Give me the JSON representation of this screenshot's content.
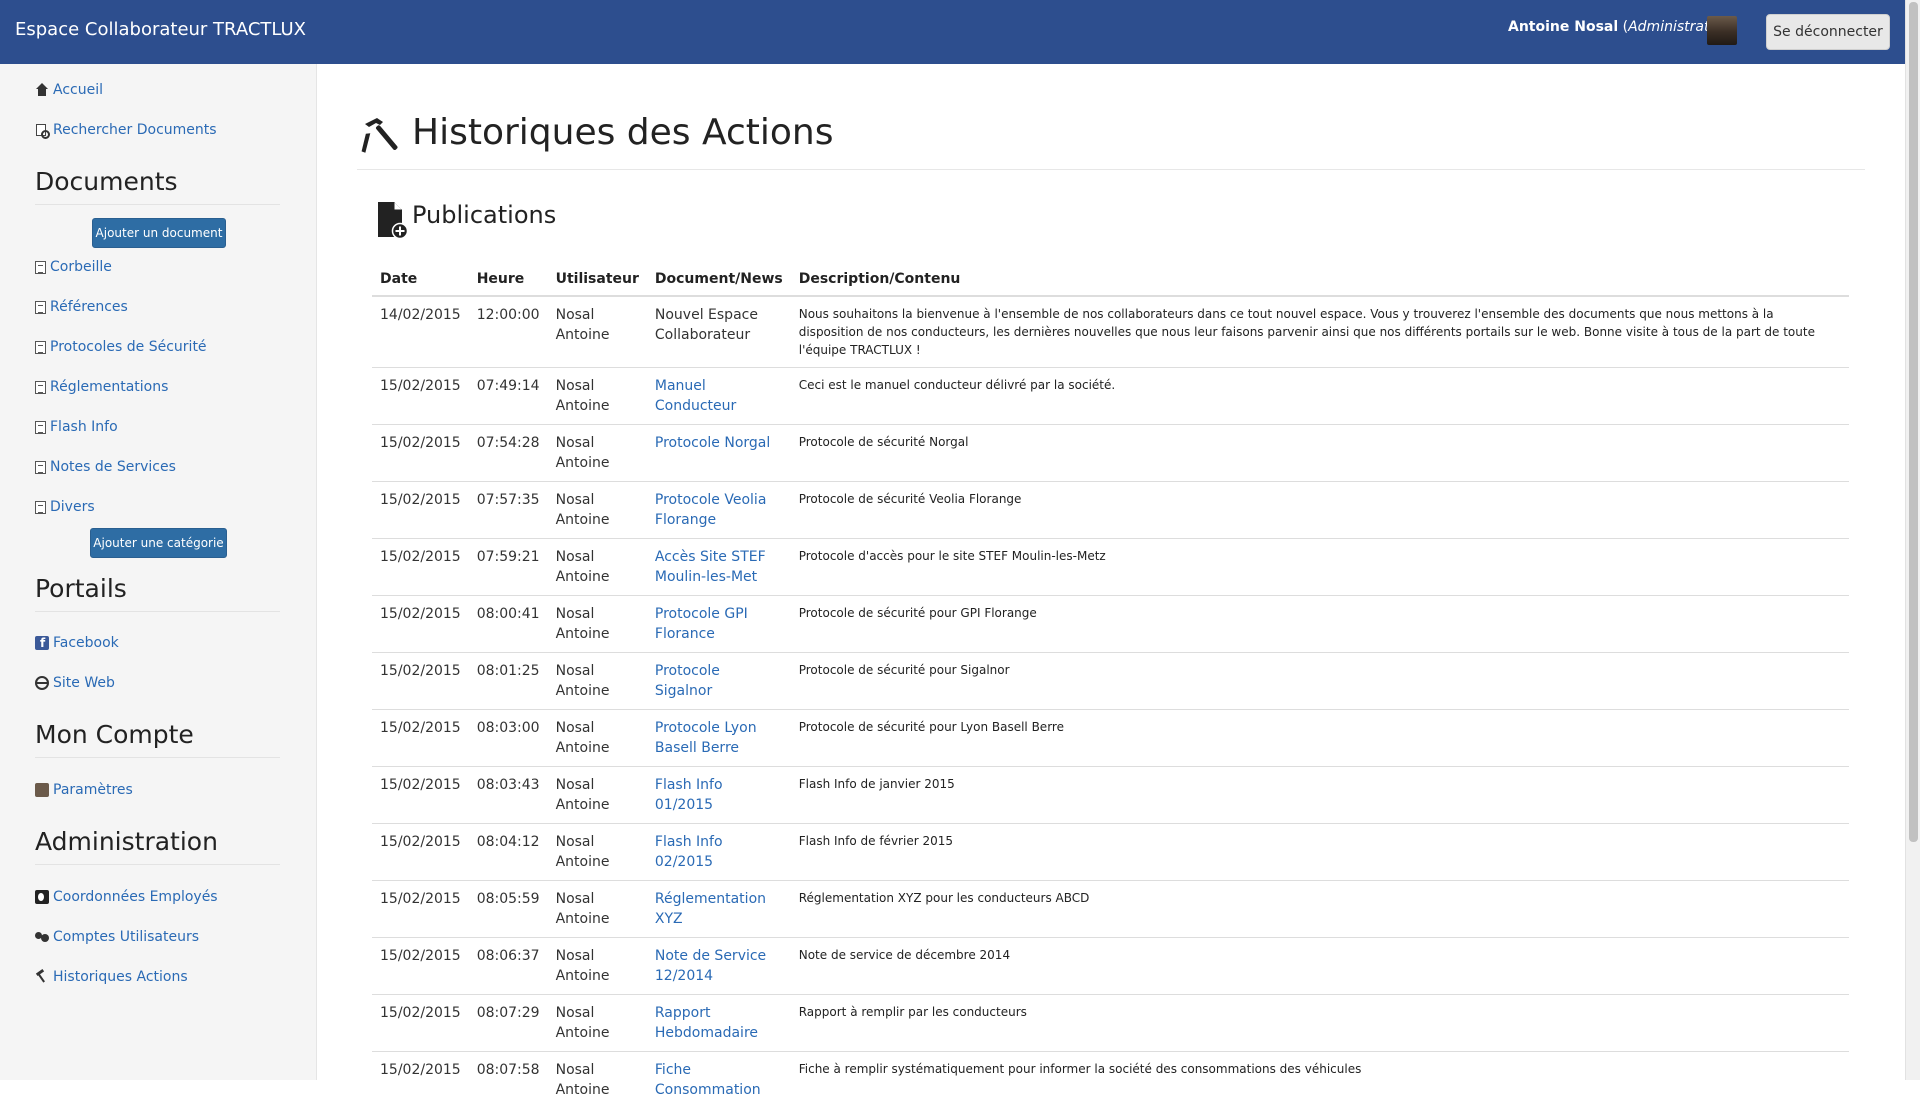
{
  "navbar": {
    "brand": "Espace Collaborateur TRACTLUX",
    "user_name": "Antoine Nosal",
    "user_role": "Administrateur",
    "logout_label": "Se déconnecter"
  },
  "sidebar": {
    "top_links": [
      {
        "label": "Accueil",
        "icon": "home-icon"
      },
      {
        "label": "Rechercher Documents",
        "icon": "search-document-icon"
      }
    ],
    "documents": {
      "title": "Documents",
      "add_document_label": "Ajouter un document",
      "items": [
        {
          "label": "Corbeille",
          "icon": "document-icon"
        },
        {
          "label": "Références",
          "icon": "document-icon"
        },
        {
          "label": "Protocoles de Sécurité",
          "icon": "document-icon"
        },
        {
          "label": "Réglementations",
          "icon": "document-icon"
        },
        {
          "label": "Flash Info",
          "icon": "document-icon"
        },
        {
          "label": "Notes de Services",
          "icon": "document-icon"
        },
        {
          "label": "Divers",
          "icon": "document-icon"
        }
      ],
      "add_category_label": "Ajouter une catégorie"
    },
    "portails": {
      "title": "Portails",
      "items": [
        {
          "label": "Facebook",
          "icon": "facebook-icon"
        },
        {
          "label": "Site Web",
          "icon": "globe-icon"
        }
      ]
    },
    "compte": {
      "title": "Mon Compte",
      "items": [
        {
          "label": "Paramètres",
          "icon": "user-photo-icon"
        }
      ]
    },
    "admin": {
      "title": "Administration",
      "items": [
        {
          "label": "Coordonnées Employés",
          "icon": "contact-card-icon"
        },
        {
          "label": "Comptes Utilisateurs",
          "icon": "users-icon"
        },
        {
          "label": "Historiques Actions",
          "icon": "hammer-icon"
        }
      ]
    }
  },
  "main": {
    "title": "Historiques des Actions",
    "section_title": "Publications",
    "columns": [
      "Date",
      "Heure",
      "Utilisateur",
      "Document/News",
      "Description/Contenu"
    ],
    "rows": [
      {
        "date": "14/02/2015",
        "time": "12:00:00",
        "user_line1": "Nosal",
        "user_line2": "Antoine",
        "doc_line1": "Nouvel Espace",
        "doc_line2": "Collaborateur",
        "doc_link": false,
        "desc": "Nous souhaitons la bienvenue à l'ensemble de nos collaborateurs dans ce tout nouvel espace. Vous y trouverez l'ensemble des documents que nous mettons à la disposition de nos conducteurs, les dernières nouvelles que nous leur faisons parvenir ainsi que nos différents portails sur le web. Bonne visite à tous de la part de toute l'équipe TRACTLUX !"
      },
      {
        "date": "15/02/2015",
        "time": "07:49:14",
        "user_line1": "Nosal",
        "user_line2": "Antoine",
        "doc_line1": "Manuel",
        "doc_line2": "Conducteur",
        "doc_link": true,
        "desc": "Ceci est le manuel conducteur délivré par la société."
      },
      {
        "date": "15/02/2015",
        "time": "07:54:28",
        "user_line1": "Nosal",
        "user_line2": "Antoine",
        "doc_line1": "Protocole Norgal",
        "doc_line2": "",
        "doc_link": true,
        "desc": "Protocole de sécurité Norgal"
      },
      {
        "date": "15/02/2015",
        "time": "07:57:35",
        "user_line1": "Nosal",
        "user_line2": "Antoine",
        "doc_line1": "Protocole Veolia",
        "doc_line2": "Florange",
        "doc_link": true,
        "desc": "Protocole de sécurité Veolia Florange"
      },
      {
        "date": "15/02/2015",
        "time": "07:59:21",
        "user_line1": "Nosal",
        "user_line2": "Antoine",
        "doc_line1": "Accès Site STEF",
        "doc_line2": "Moulin-les-Met",
        "doc_link": true,
        "desc": "Protocole d'accès pour le site STEF Moulin-les-Metz"
      },
      {
        "date": "15/02/2015",
        "time": "08:00:41",
        "user_line1": "Nosal",
        "user_line2": "Antoine",
        "doc_line1": "Protocole GPI",
        "doc_line2": "Florance",
        "doc_link": true,
        "desc": "Protocole de sécurité pour GPI Florange"
      },
      {
        "date": "15/02/2015",
        "time": "08:01:25",
        "user_line1": "Nosal",
        "user_line2": "Antoine",
        "doc_line1": "Protocole",
        "doc_line2": "Sigalnor",
        "doc_link": true,
        "desc": "Protocole de sécurité pour Sigalnor"
      },
      {
        "date": "15/02/2015",
        "time": "08:03:00",
        "user_line1": "Nosal",
        "user_line2": "Antoine",
        "doc_line1": "Protocole Lyon",
        "doc_line2": "Basell Berre",
        "doc_link": true,
        "desc": "Protocole de sécurité pour Lyon Basell Berre"
      },
      {
        "date": "15/02/2015",
        "time": "08:03:43",
        "user_line1": "Nosal",
        "user_line2": "Antoine",
        "doc_line1": "Flash Info",
        "doc_line2": "01/2015",
        "doc_link": true,
        "desc": "Flash Info de janvier 2015"
      },
      {
        "date": "15/02/2015",
        "time": "08:04:12",
        "user_line1": "Nosal",
        "user_line2": "Antoine",
        "doc_line1": "Flash Info",
        "doc_line2": "02/2015",
        "doc_link": true,
        "desc": "Flash Info de février 2015"
      },
      {
        "date": "15/02/2015",
        "time": "08:05:59",
        "user_line1": "Nosal",
        "user_line2": "Antoine",
        "doc_line1": "Réglementation",
        "doc_line2": "XYZ",
        "doc_link": true,
        "desc": "Réglementation XYZ pour les conducteurs ABCD"
      },
      {
        "date": "15/02/2015",
        "time": "08:06:37",
        "user_line1": "Nosal",
        "user_line2": "Antoine",
        "doc_line1": "Note de Service",
        "doc_line2": "12/2014",
        "doc_link": true,
        "desc": "Note de service de décembre 2014"
      },
      {
        "date": "15/02/2015",
        "time": "08:07:29",
        "user_line1": "Nosal",
        "user_line2": "Antoine",
        "doc_line1": "Rapport",
        "doc_line2": "Hebdomadaire",
        "doc_link": true,
        "desc": "Rapport à remplir par les conducteurs"
      },
      {
        "date": "15/02/2015",
        "time": "08:07:58",
        "user_line1": "Nosal",
        "user_line2": "Antoine",
        "doc_line1": "Fiche",
        "doc_line2": "Consommation",
        "doc_link": true,
        "desc": "Fiche à remplir systématiquement pour informer la société des consommations des véhicules"
      }
    ]
  },
  "colors": {
    "navbar": "#2d4e8e",
    "link": "#2a6ab5",
    "button": "#2e6da4",
    "sidebar_bg": "#f5f5f5"
  }
}
